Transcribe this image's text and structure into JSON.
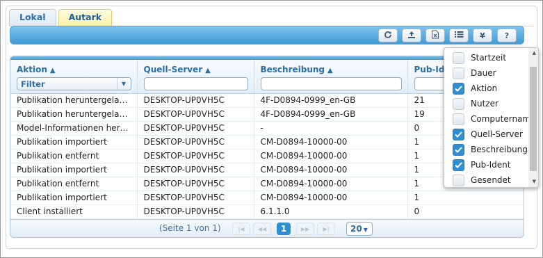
{
  "tabs": [
    "Lokal",
    "Autark"
  ],
  "toolbar": {
    "icons": [
      "refresh-icon",
      "upload-icon",
      "excel-export-icon",
      "column-list-icon",
      "currency-yen-icon",
      "help-icon"
    ],
    "yen_label": "¥",
    "help_label": "?"
  },
  "columns": {
    "aktion": "Aktion",
    "aktion_filter": "Filter",
    "quell": "Quell-Server",
    "beschreibung": "Beschreibung",
    "pubident": "Pub-Id"
  },
  "rows": [
    {
      "aktion": "Publikation heruntergeladen",
      "quell": "DESKTOP-UP0VH5C",
      "beschreibung": "4F-D0894-0999_en-GB",
      "pub": "21"
    },
    {
      "aktion": "Publikation heruntergeladen",
      "quell": "DESKTOP-UP0VH5C",
      "beschreibung": "4F-D0894-0999_en-GB",
      "pub": "19"
    },
    {
      "aktion": "Model-Informationen heru…",
      "quell": "DESKTOP-UP0VH5C",
      "beschreibung": "-",
      "pub": "0"
    },
    {
      "aktion": "Publikation importiert",
      "quell": "DESKTOP-UP0VH5C",
      "beschreibung": "CM-D0894-10000-00",
      "pub": "1"
    },
    {
      "aktion": "Publikation entfernt",
      "quell": "DESKTOP-UP0VH5C",
      "beschreibung": "CM-D0894-10000-00",
      "pub": "1"
    },
    {
      "aktion": "Publikation importiert",
      "quell": "DESKTOP-UP0VH5C",
      "beschreibung": "CM-D0894-10000-00",
      "pub": "1"
    },
    {
      "aktion": "Publikation entfernt",
      "quell": "DESKTOP-UP0VH5C",
      "beschreibung": "CM-D0894-10000-00",
      "pub": "1"
    },
    {
      "aktion": "Publikation importiert",
      "quell": "DESKTOP-UP0VH5C",
      "beschreibung": "CM-D0894-10000-00",
      "pub": "1"
    },
    {
      "aktion": "Client installiert",
      "quell": "DESKTOP-UP0VH5C",
      "beschreibung": "6.1.1.0",
      "pub": "0"
    }
  ],
  "pager": {
    "info": "(Seite 1 von 1)",
    "current": "1",
    "page_size": "20"
  },
  "column_chooser": {
    "items": [
      {
        "label": "Startzeit",
        "checked": false
      },
      {
        "label": "Dauer",
        "checked": false
      },
      {
        "label": "Aktion",
        "checked": true
      },
      {
        "label": "Nutzer",
        "checked": false
      },
      {
        "label": "Computernam",
        "checked": false
      },
      {
        "label": "Quell-Server",
        "checked": true
      },
      {
        "label": "Beschreibung",
        "checked": true
      },
      {
        "label": "Pub-Ident",
        "checked": true
      },
      {
        "label": "Gesendet",
        "checked": false
      }
    ]
  },
  "colors": {
    "accent": "#2f8fd4",
    "header_text": "#2c6da5",
    "active_tab": "#fbf3a8"
  }
}
